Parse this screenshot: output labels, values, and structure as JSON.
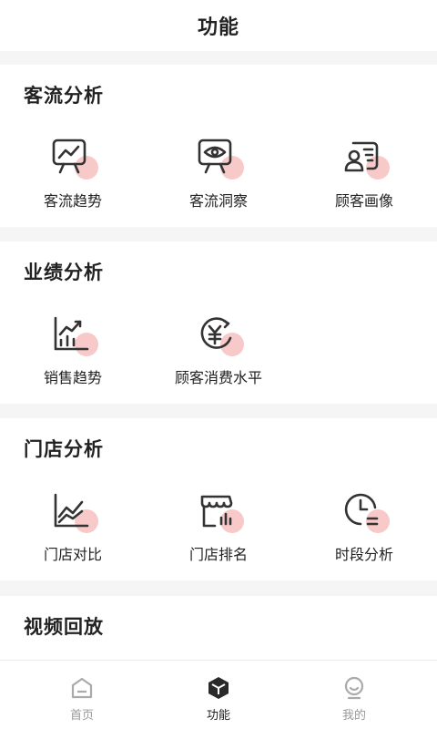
{
  "header": {
    "title": "功能"
  },
  "sections": [
    {
      "title": "客流分析",
      "items": [
        {
          "label": "客流趋势",
          "icon": "presentation-trend-icon"
        },
        {
          "label": "客流洞察",
          "icon": "presentation-eye-icon"
        },
        {
          "label": "顾客画像",
          "icon": "user-profile-icon"
        }
      ]
    },
    {
      "title": "业绩分析",
      "items": [
        {
          "label": "销售趋势",
          "icon": "bar-chart-up-icon"
        },
        {
          "label": "顾客消费水平",
          "icon": "yen-circle-icon"
        }
      ]
    },
    {
      "title": "门店分析",
      "items": [
        {
          "label": "门店对比",
          "icon": "area-chart-icon"
        },
        {
          "label": "门店排名",
          "icon": "store-rank-icon"
        },
        {
          "label": "时段分析",
          "icon": "clock-list-icon"
        }
      ]
    },
    {
      "title": "视频回放",
      "items": []
    }
  ],
  "tabbar": {
    "active": 1,
    "tabs": [
      {
        "label": "首页",
        "icon": "home-icon"
      },
      {
        "label": "功能",
        "icon": "cube-icon"
      },
      {
        "label": "我的",
        "icon": "user-icon"
      }
    ]
  },
  "colors": {
    "accent_soft": "#f7c9c9",
    "icon_stroke": "#333333",
    "page_bg": "#f5f5f5"
  }
}
